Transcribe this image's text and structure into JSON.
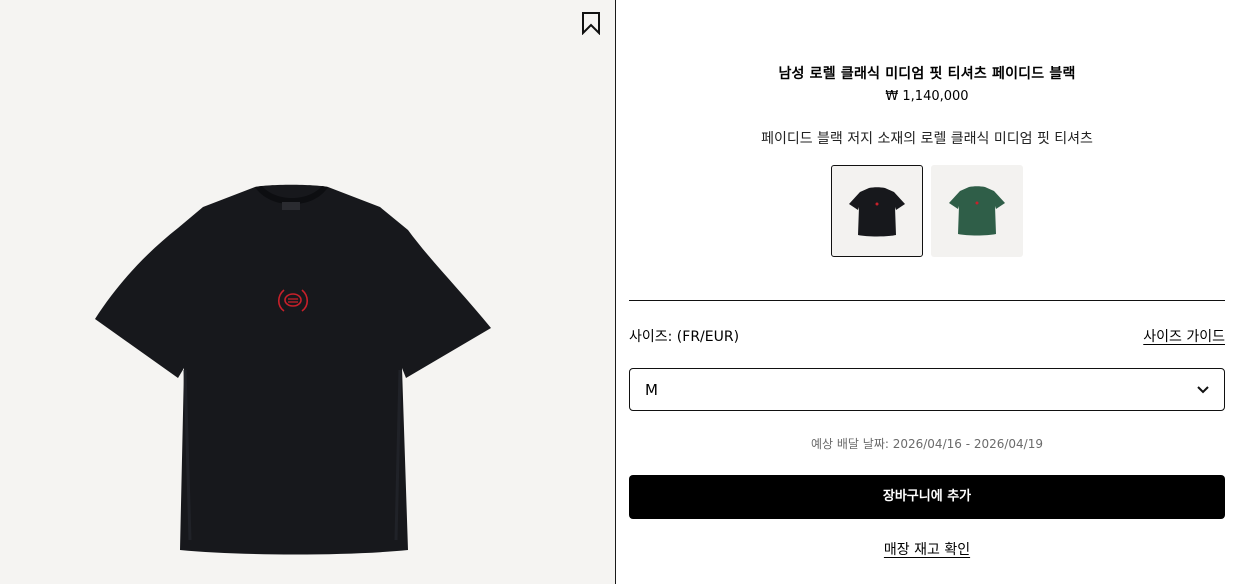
{
  "product": {
    "title": "남성 로렐 클래식 미디엄 핏 티셔츠 페이디드 블랙",
    "price": "₩ 1,140,000",
    "description": "페이디드 블랙 저지 소재의 로렐 클래식 미디엄 핏 티셔츠",
    "image_icon": "t-shirt-image",
    "colors": {
      "shirt_black": "#17181c",
      "shirt_green": "#2f5e48",
      "embroidery": "#c8202a"
    }
  },
  "swatches": [
    {
      "name": "black",
      "color": "#17181c",
      "selected": true
    },
    {
      "name": "green",
      "color": "#2f5e48",
      "selected": false
    }
  ],
  "size": {
    "label": "사이즈: (FR/EUR)",
    "guide_label": "사이즈 가이드",
    "selected_value": "M"
  },
  "delivery": {
    "text": "예상 배달 날짜: 2026/04/16 - 2026/04/19"
  },
  "actions": {
    "add_to_cart_label": "장바구니에 추가",
    "check_stock_label": "매장 재고 확인"
  }
}
